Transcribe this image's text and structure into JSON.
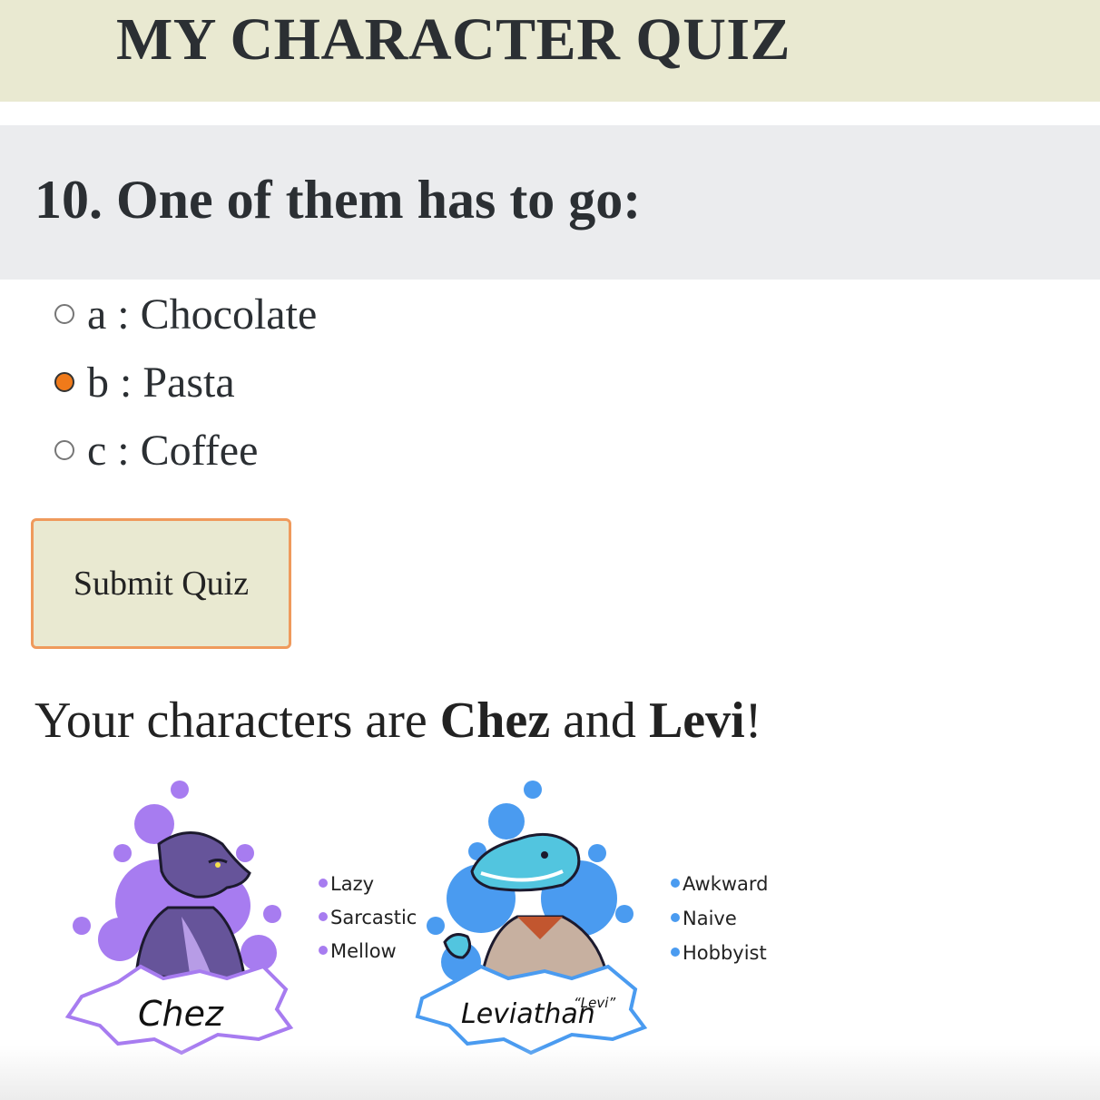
{
  "header": {
    "title": "MY CHARACTER QUIZ"
  },
  "question": {
    "text": "10. One of them has to go:",
    "options": [
      {
        "label": "a : Chocolate",
        "checked": false
      },
      {
        "label": "b : Pasta",
        "checked": true
      },
      {
        "label": "c : Coffee",
        "checked": false
      }
    ]
  },
  "submit": {
    "label": "Submit Quiz"
  },
  "result": {
    "prefix": "Your characters are ",
    "name1": "Chez",
    "joiner": " and ",
    "name2": "Levi",
    "suffix": "!"
  },
  "characters": [
    {
      "name_tag": "Chez",
      "traits": [
        "Lazy",
        "Sarcastic",
        "Mellow"
      ],
      "accent_color": "#a77cf0",
      "body_color": "#66549a"
    },
    {
      "name_tag": "Leviathan",
      "nickname": "“Levi”",
      "traits": [
        "Awkward",
        "Naive",
        "Hobbyist"
      ],
      "accent_color": "#4a9bf0",
      "body_color": "#52c5df"
    }
  ],
  "colors": {
    "header_bg": "#e9e9d1",
    "question_bg": "#ebecee",
    "button_border": "#ef9a5c",
    "radio_checked": "#f07a1a"
  }
}
